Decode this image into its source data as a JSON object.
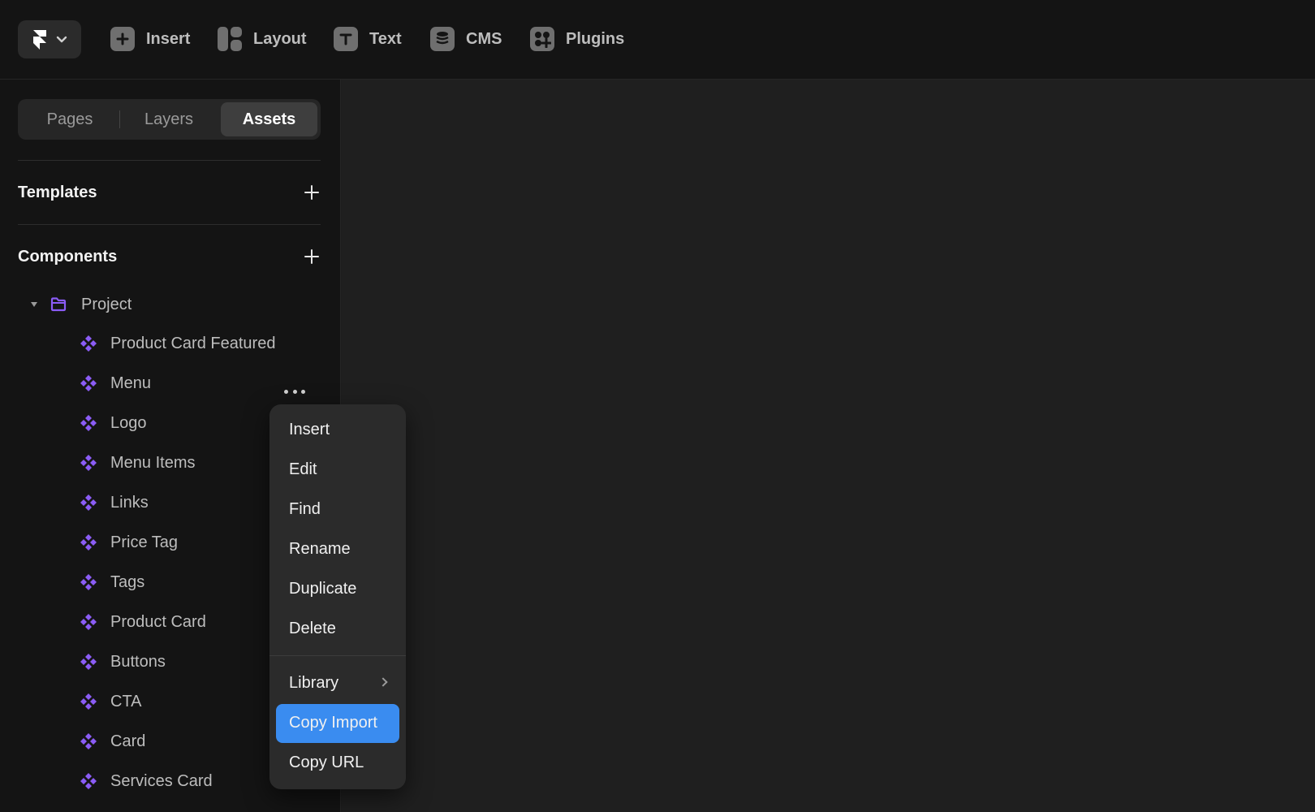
{
  "colors": {
    "topbar_bg": "#141414",
    "sidebar_bg": "#141414",
    "canvas_bg": "#1f1f1f",
    "menu_bg": "#2b2b2b",
    "accent_blue": "#3a8cf0",
    "component_purple": "#8b5cf6"
  },
  "toolbar": {
    "logo_icon": "framer-logo-icon",
    "dropdown_icon": "chevron-down-icon",
    "items": [
      {
        "label": "Insert",
        "icon": "plus-square-icon"
      },
      {
        "label": "Layout",
        "icon": "layout-icon"
      },
      {
        "label": "Text",
        "icon": "text-icon"
      },
      {
        "label": "CMS",
        "icon": "database-icon"
      },
      {
        "label": "Plugins",
        "icon": "plugins-icon"
      }
    ]
  },
  "sidebar": {
    "tabs": [
      {
        "label": "Pages",
        "active": false
      },
      {
        "label": "Layers",
        "active": false
      },
      {
        "label": "Assets",
        "active": true
      }
    ],
    "templates": {
      "title": "Templates"
    },
    "components": {
      "title": "Components",
      "folder": {
        "label": "Project",
        "icon": "folder-icon"
      },
      "items": [
        "Product Card Featured",
        "Menu",
        "Logo",
        "Menu Items",
        "Links",
        "Price Tag",
        "Tags",
        "Product Card",
        "Buttons",
        "CTA",
        "Card",
        "Services Card"
      ]
    }
  },
  "context_menu": {
    "items": [
      "Insert",
      "Edit",
      "Find",
      "Rename",
      "Duplicate",
      "Delete"
    ],
    "library": "Library",
    "copy_import": "Copy Import",
    "copy_url": "Copy URL"
  }
}
